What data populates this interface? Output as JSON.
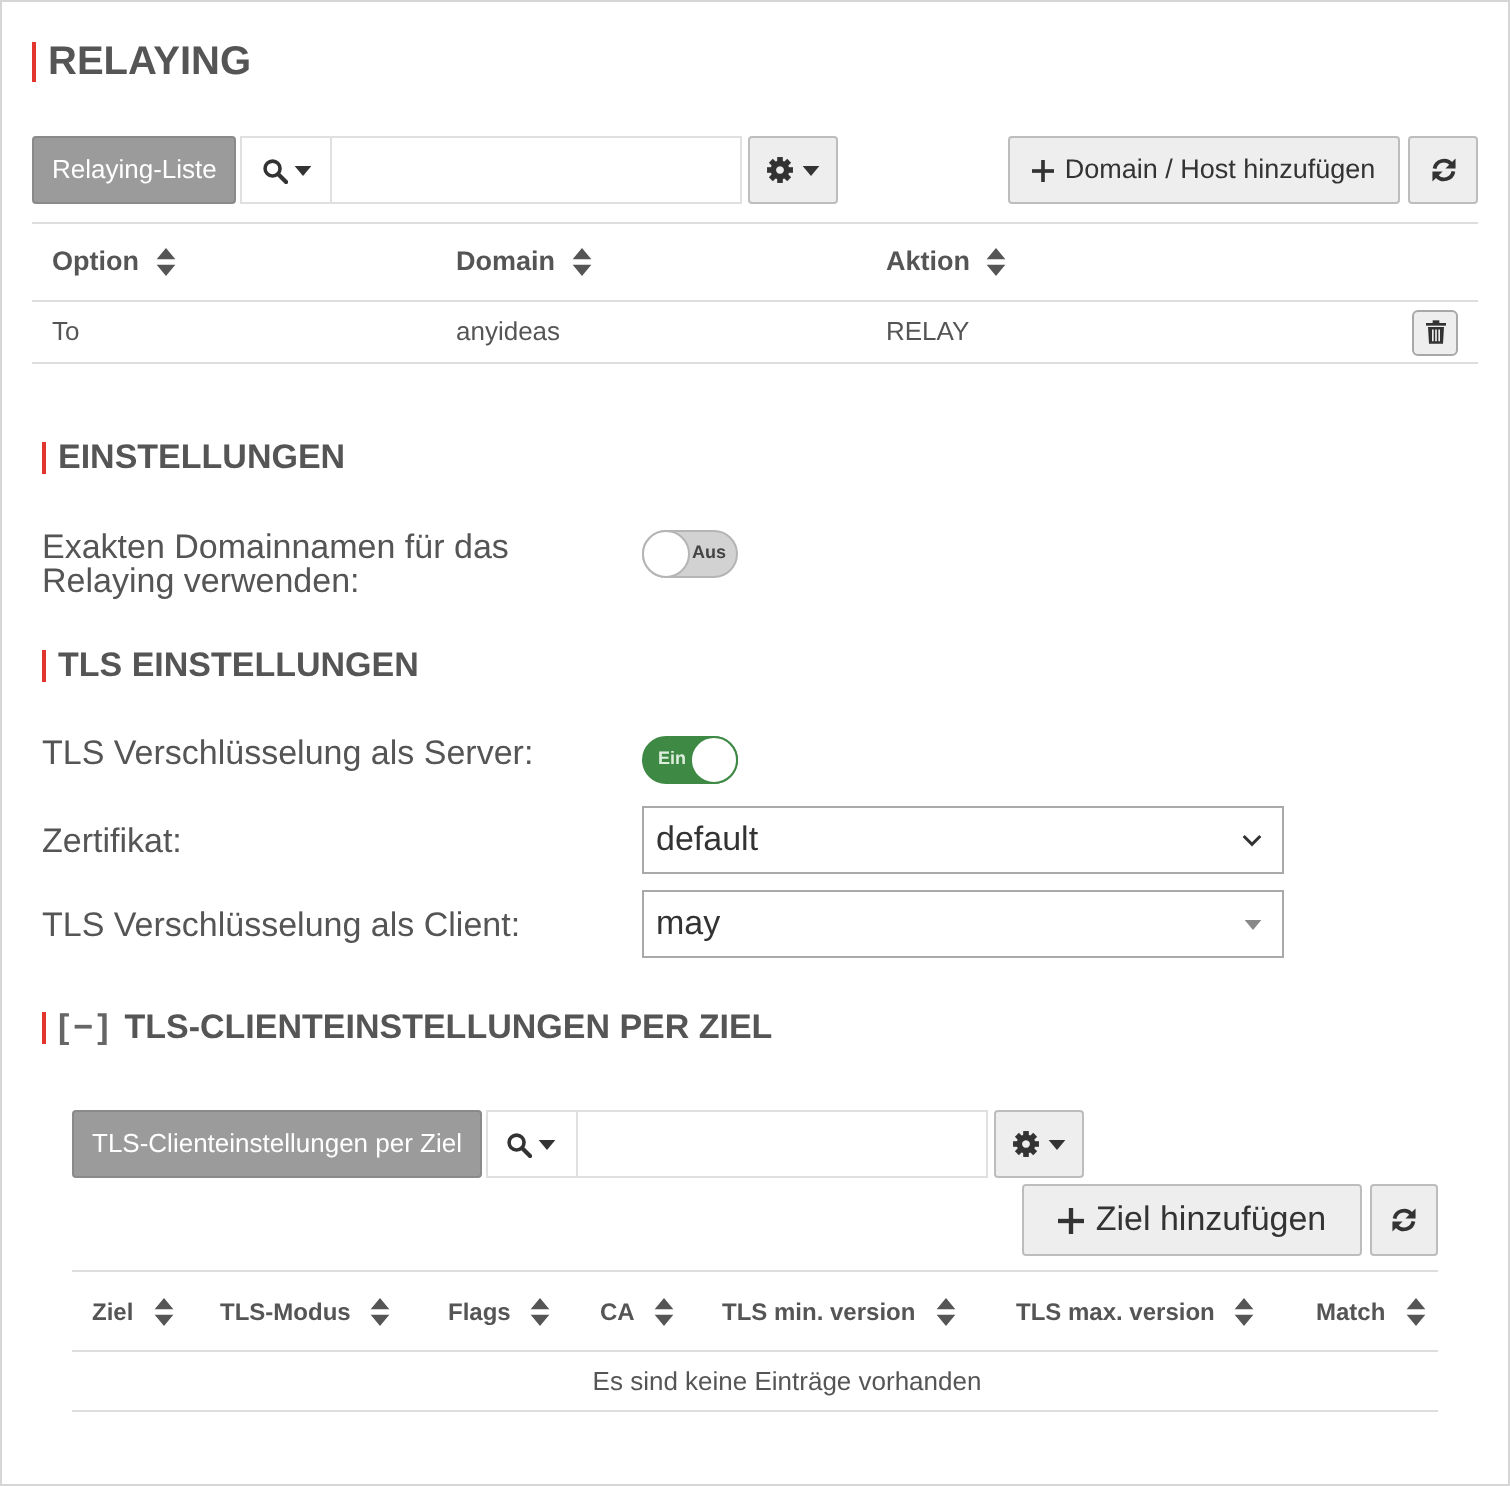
{
  "title": "RELAYING",
  "relaying_toolbar": {
    "list_label": "Relaying-Liste",
    "add_button": "Domain / Host hinzufügen"
  },
  "relaying_table": {
    "columns": [
      "Option",
      "Domain",
      "Aktion"
    ],
    "rows": [
      {
        "cells": [
          "To",
          "anyideas",
          "RELAY"
        ]
      }
    ]
  },
  "settings": {
    "title": "EINSTELLUNGEN",
    "fields": [
      {
        "kind": "toggle",
        "label": "Exakten Domainnamen für das Relaying verwenden:",
        "on": false,
        "state_text": "Aus"
      }
    ]
  },
  "tls_settings": {
    "title": "TLS EINSTELLUNGEN",
    "fields": [
      {
        "kind": "toggle",
        "label": "TLS Verschlüsselung als Server:",
        "on": true,
        "state_text": "Ein"
      },
      {
        "kind": "select",
        "label": "Zertifikat:",
        "value": "default"
      },
      {
        "kind": "dropdown",
        "label": "TLS Verschlüsselung als Client:",
        "value": "may"
      }
    ]
  },
  "tls_client_settings": {
    "collapse_toggle": "[−]",
    "title": "TLS-CLIENTEINSTELLUNGEN PER ZIEL",
    "toolbar": {
      "list_label": "TLS-Clienteinstellungen per Ziel",
      "add_button": "Ziel hinzufügen"
    },
    "table": {
      "columns": [
        "Ziel",
        "TLS-Modus",
        "Flags",
        "CA",
        "TLS min. version",
        "TLS max. version",
        "Match"
      ],
      "empty_message": "Es sind keine Einträge vorhanden"
    }
  }
}
